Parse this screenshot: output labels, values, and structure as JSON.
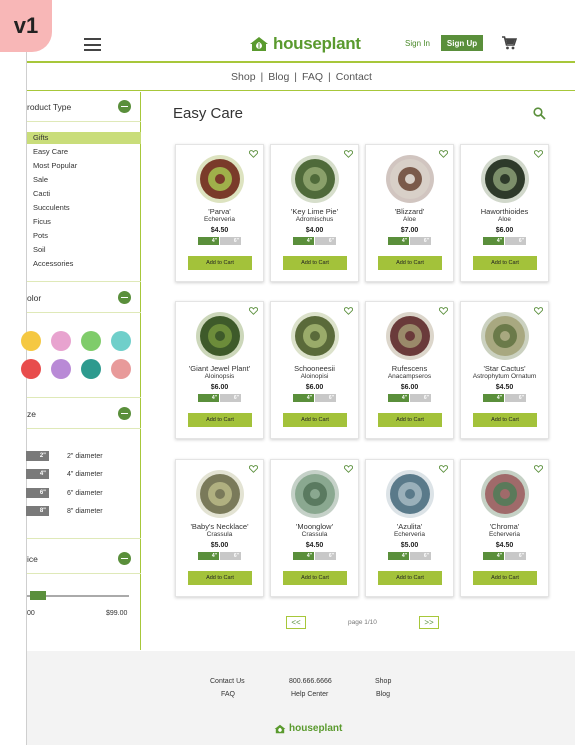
{
  "badge": "v1",
  "header": {
    "logo": "houseplant",
    "sign_in": "Sign In",
    "sign_up": "Sign Up"
  },
  "topnav": [
    "Shop",
    "Blog",
    "FAQ",
    "Contact"
  ],
  "sidebar": {
    "product_type_title": "roduct Type",
    "categories": [
      "Gifts",
      "Easy Care",
      "Most Popular",
      "Sale",
      "Cacti",
      "Succulents",
      "Ficus",
      "Pots",
      "Soil",
      "Accessories"
    ],
    "color_title": "olor",
    "colors": [
      "#f5c842",
      "#e8a3cf",
      "#7fcc6a",
      "#6fcfca",
      "#e84c4c",
      "#b98ad6",
      "#2d9a8e",
      "#e89a9a"
    ],
    "size_title": "ze",
    "sizes": [
      {
        "chip": "2\"",
        "label": "2\" diameter"
      },
      {
        "chip": "4\"",
        "label": "4\" diameter"
      },
      {
        "chip": "6\"",
        "label": "6\" diameter"
      },
      {
        "chip": "8\"",
        "label": "8\" diameter"
      }
    ],
    "price_title": "ice",
    "price_min": "00",
    "price_max": "$99.00"
  },
  "main": {
    "title": "Easy Care",
    "add_label": "Add to Cart",
    "size_chips": [
      "4\"",
      "6\""
    ],
    "products": [
      {
        "name": "'Parva'",
        "latin": "Echerveria",
        "price": "$4.50"
      },
      {
        "name": "'Key Lime Pie'",
        "latin": "Adromischus",
        "price": "$4.00"
      },
      {
        "name": "'Blizzard'",
        "latin": "Aloe",
        "price": "$7.00"
      },
      {
        "name": "Haworthioides",
        "latin": "Aloe",
        "price": "$6.00"
      },
      {
        "name": "'Giant Jewel Plant'",
        "latin": "Aloinopsis",
        "price": "$6.00"
      },
      {
        "name": "Schooneesii",
        "latin": "Aloinopisi",
        "price": "$6.00"
      },
      {
        "name": "Rufescens",
        "latin": "Anacampseros",
        "price": "$6.00"
      },
      {
        "name": "'Star Cactus'",
        "latin": "Astrophytum Ornatum",
        "price": "$4.50"
      },
      {
        "name": "'Baby's Necklace'",
        "latin": "Crassula",
        "price": "$5.00"
      },
      {
        "name": "'Moonglow'",
        "latin": "Crassula",
        "price": "$4.50"
      },
      {
        "name": "'Azulita'",
        "latin": "Echerveria",
        "price": "$5.00"
      },
      {
        "name": "'Chroma'",
        "latin": "Echerveria",
        "price": "$4.50"
      }
    ],
    "pager": {
      "prev": "<<",
      "text": "page 1/10",
      "next": ">>"
    }
  },
  "footer": {
    "col1": [
      "Contact Us",
      "FAQ"
    ],
    "col2": [
      "800.666.6666",
      "Help Center"
    ],
    "col3": [
      "Shop",
      "Blog"
    ],
    "logo": "houseplant"
  },
  "colors": {
    "accent": "#a7c73a",
    "brand": "#5a8f3b"
  }
}
